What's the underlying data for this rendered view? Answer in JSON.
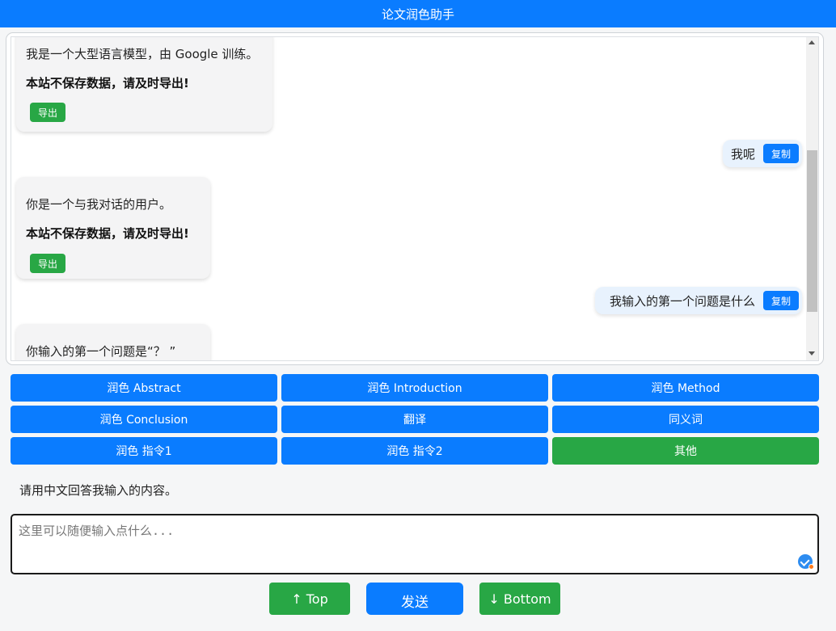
{
  "header": {
    "title": "论文润色助手"
  },
  "chat": {
    "messages": [
      {
        "role": "assistant",
        "text": "我是一个大型语言模型，由 Google 训练。",
        "notice": "本站不保存数据，请及时导出!",
        "export_label": "导出"
      },
      {
        "role": "user",
        "text": "我呢",
        "copy_label": "复制"
      },
      {
        "role": "assistant",
        "text": "你是一个与我对话的用户。",
        "notice": "本站不保存数据，请及时导出!",
        "export_label": "导出"
      },
      {
        "role": "user",
        "text": "我输入的第一个问题是什么",
        "copy_label": "复制"
      },
      {
        "role": "assistant",
        "text": "你输入的第一个问题是“？ ”"
      }
    ]
  },
  "prompt_buttons": [
    {
      "label": "润色 Abstract"
    },
    {
      "label": "润色 Introduction"
    },
    {
      "label": "润色 Method"
    },
    {
      "label": "润色 Conclusion"
    },
    {
      "label": "翻译"
    },
    {
      "label": "同义词"
    },
    {
      "label": "润色 指令1"
    },
    {
      "label": "润色 指令2"
    },
    {
      "label": "其他"
    }
  ],
  "hint": "请用中文回答我输入的内容。",
  "input": {
    "placeholder": "这里可以随便输入点什么...",
    "value": ""
  },
  "actions": {
    "top_label": "↑ Top",
    "send_label": "发送",
    "bottom_label": "↓ Bottom"
  },
  "colors": {
    "primary": "#0a7cff",
    "success": "#28a745",
    "user_bubble": "#e8f2fd",
    "assistant_bubble": "#f4f4f5"
  },
  "icons": {
    "grammar_check": "grammar-check-icon",
    "scroll_up": "scroll-up-arrow-icon",
    "scroll_down": "scroll-down-arrow-icon"
  }
}
